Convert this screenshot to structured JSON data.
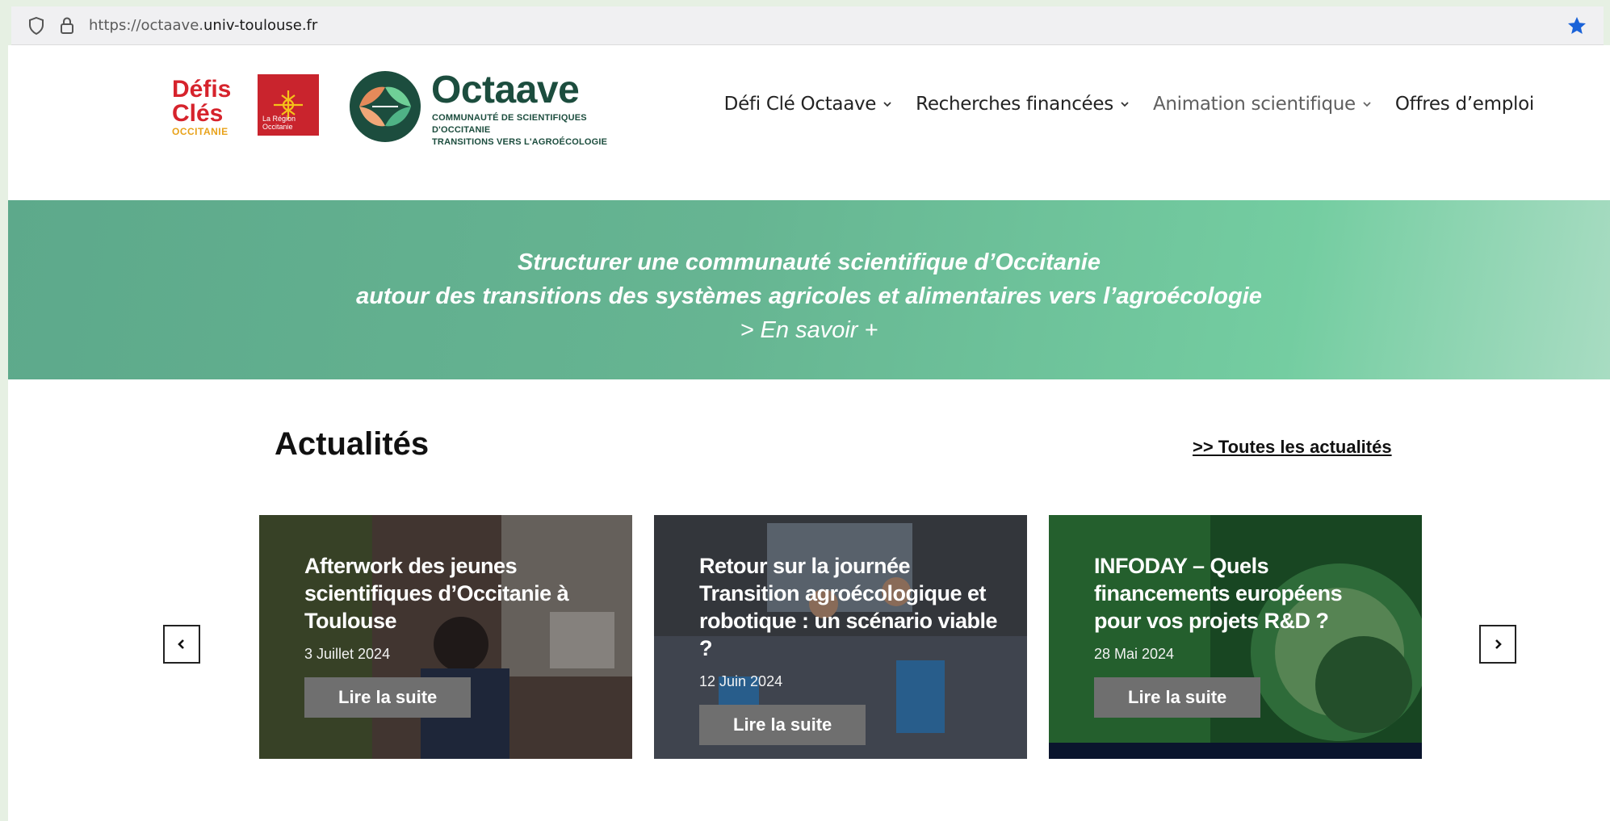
{
  "browser": {
    "url_prefix": "https://octaave.",
    "url_domain": "univ-toulouse.fr",
    "icons": [
      "shield-icon",
      "lock-icon",
      "star-icon"
    ]
  },
  "header": {
    "logo_defis": {
      "line1": "Défis",
      "line2": "Clés",
      "line3": "OCCITANIE"
    },
    "logo_region": {
      "text": "La Région Occitanie"
    },
    "logo_octaave": {
      "title": "Octaave",
      "subtitle_line1": "COMMUNAUTÉ DE SCIENTIFIQUES D'OCCITANIE",
      "subtitle_line2": "TRANSITIONS VERS L'AGROÉCOLOGIE"
    },
    "nav": [
      {
        "label": "Défi Clé Octaave",
        "has_dropdown": true
      },
      {
        "label": "Recherches financées",
        "has_dropdown": true
      },
      {
        "label": "Animation scientifique",
        "has_dropdown": true
      },
      {
        "label": "Offres d’emploi",
        "has_dropdown": false
      }
    ]
  },
  "hero": {
    "line1": "Structurer une communauté scientifique d’Occitanie",
    "line2": "autour des transitions des systèmes agricoles et alimentaires vers l’agroécologie",
    "link": "> En savoir +"
  },
  "news": {
    "title": "Actualités",
    "all_link": ">> Toutes les actualités",
    "cards": [
      {
        "title": "Afterwork des jeunes scientifiques d’Occitanie à Toulouse",
        "date": "3 Juillet 2024",
        "button": "Lire la suite"
      },
      {
        "title": "Retour sur la journée Transition agroécologique et robotique : un scénario viable ?",
        "date": "12 Juin 2024",
        "button": "Lire la suite"
      },
      {
        "title": "INFODAY – Quels financements européens pour vos projets R&D ?",
        "date": "28 Mai 2024",
        "button": "Lire la suite"
      }
    ],
    "prev_icon": "chevron-left-icon",
    "next_icon": "chevron-right-icon"
  },
  "colors": {
    "hero_start": "#5da98b",
    "hero_end": "#74cda1",
    "octaave_dark": "#1c4d3e",
    "defis_red": "#d6232c",
    "button_grey": "#6f6f6f"
  }
}
